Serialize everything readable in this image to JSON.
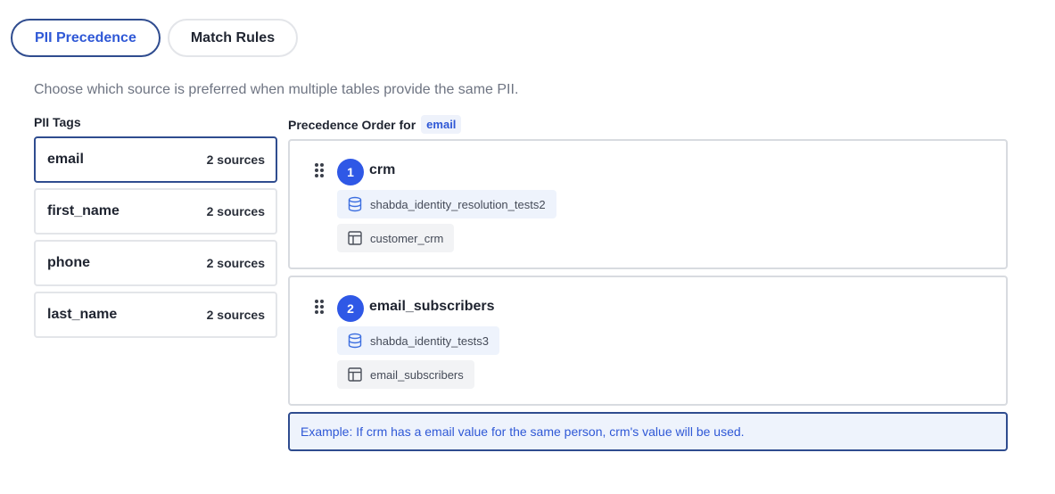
{
  "tabs": [
    {
      "label": "PII Precedence",
      "active": true
    },
    {
      "label": "Match Rules",
      "active": false
    }
  ],
  "description": "Choose which source is preferred when multiple tables provide the same PII.",
  "tags_panel": {
    "title": "PII Tags",
    "items": [
      {
        "name": "email",
        "count": "2 sources",
        "selected": true
      },
      {
        "name": "first_name",
        "count": "2 sources",
        "selected": false
      },
      {
        "name": "phone",
        "count": "2 sources",
        "selected": false
      },
      {
        "name": "last_name",
        "count": "2 sources",
        "selected": false
      }
    ]
  },
  "precedence": {
    "title": "Precedence Order for",
    "selected_tag": "email",
    "sources": [
      {
        "rank": "1",
        "name": "crm",
        "database": "shabda_identity_resolution_tests2",
        "table": "customer_crm"
      },
      {
        "rank": "2",
        "name": "email_subscribers",
        "database": "shabda_identity_tests3",
        "table": "email_subscribers"
      }
    ],
    "example": "Example: If crm has a email value for the same person, crm's value will be used."
  },
  "colors": {
    "accent": "#2f58e6",
    "active_border": "#2f4c8f",
    "chip_db_bg": "#eef3fc",
    "chip_table_bg": "#f2f3f5"
  },
  "icons": {
    "drag": "drag-handle-icon",
    "database": "database-icon",
    "table": "table-icon"
  }
}
